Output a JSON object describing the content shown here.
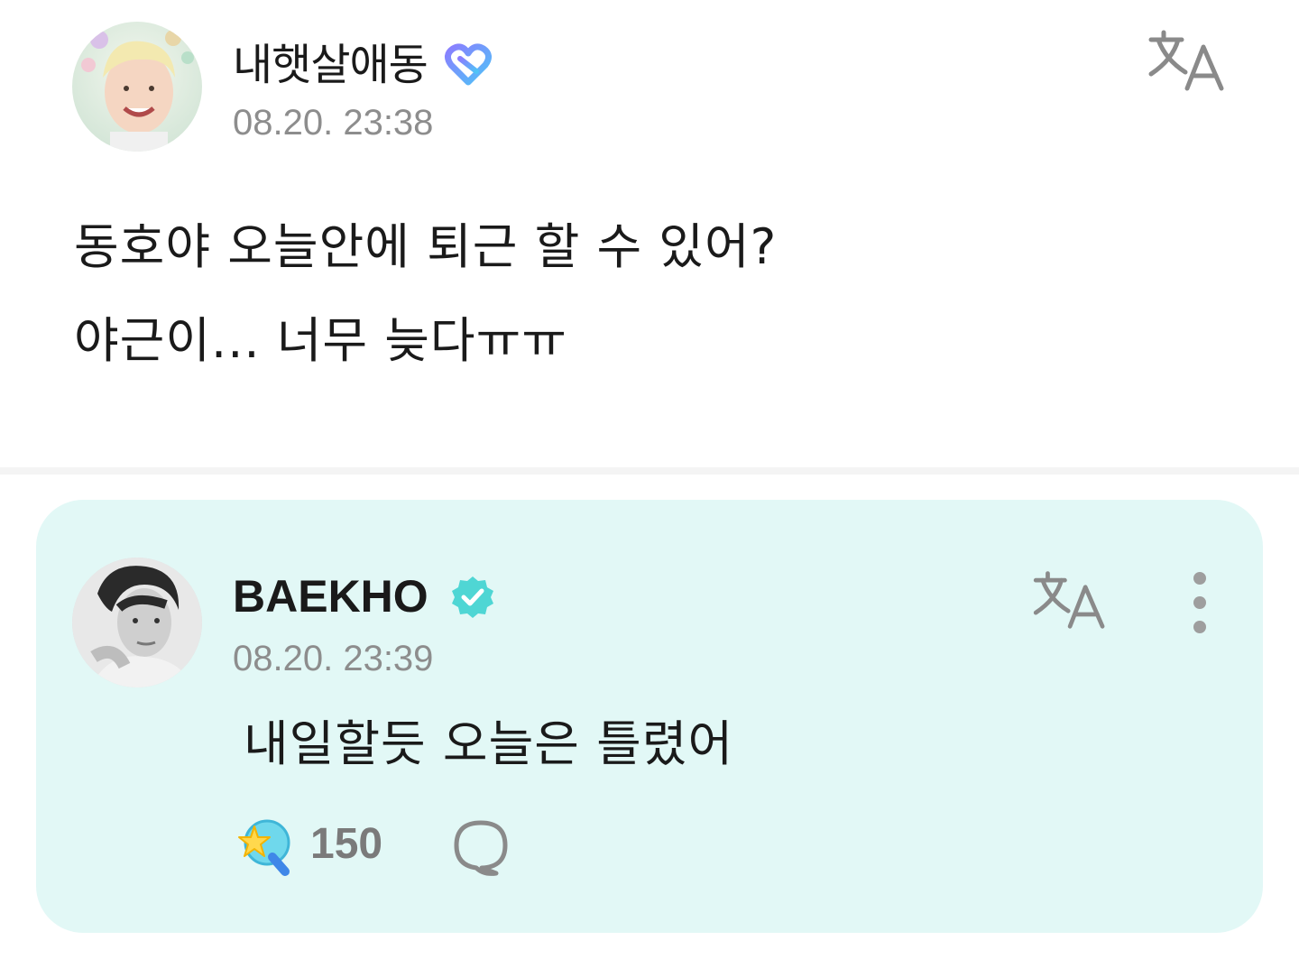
{
  "post": {
    "username": "내햇살애동",
    "user_badge_icon": "heart-badge-icon",
    "timestamp": "08.20. 23:38",
    "translate_icon": "translate-icon",
    "body_lines": [
      "동호야 오늘안에 퇴근 할 수 있어?",
      "야근이... 너무 늦다ㅠㅠ"
    ]
  },
  "reply": {
    "username": "BAEKHO",
    "verified_icon": "verified-badge-icon",
    "timestamp": "08.20. 23:39",
    "translate_icon": "translate-icon",
    "more_icon": "more-vertical-icon",
    "text": "내일할듯 오늘은 틀렸어",
    "like_icon": "lightstick-like-icon",
    "like_count": "150",
    "comment_icon": "comment-bubble-icon"
  },
  "colors": {
    "card_background": "#e2f8f6",
    "timestamp": "#8d8d8d",
    "verified": "#4fd6d4",
    "badge_gradient_start": "#8b7dff",
    "badge_gradient_end": "#4fc3f7"
  }
}
